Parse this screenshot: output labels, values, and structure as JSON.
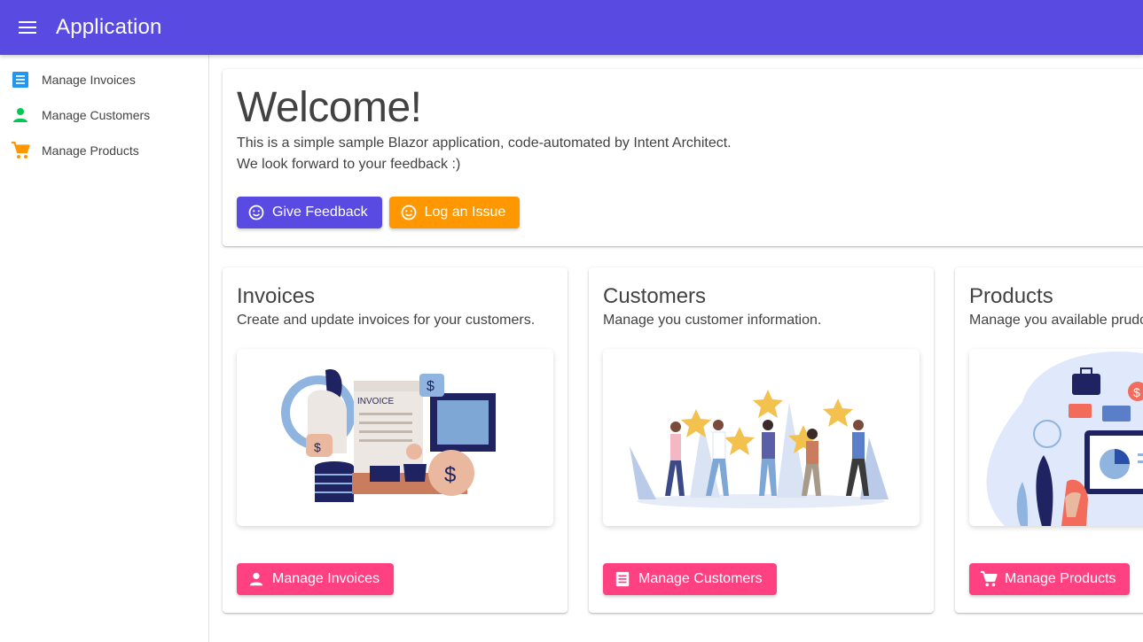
{
  "app": {
    "title": "Application",
    "brand_color": "#594ae2"
  },
  "nav": {
    "items": [
      {
        "label": "Manage Invoices",
        "icon": "receipt-icon",
        "color": "#2196f3"
      },
      {
        "label": "Manage Customers",
        "icon": "person-icon",
        "color": "#00c853"
      },
      {
        "label": "Manage Products",
        "icon": "cart-icon",
        "color": "#ff9800"
      }
    ]
  },
  "welcome": {
    "title": "Welcome!",
    "line1": "This is a simple sample Blazor application, code-automated by Intent Architect.",
    "line2": "We look forward to your feedback :)",
    "feedback_label": "Give Feedback",
    "issue_label": "Log an Issue"
  },
  "cards": [
    {
      "title": "Invoices",
      "description": "Create and update invoices for your customers.",
      "button_label": "Manage Invoices",
      "button_icon": "person-icon",
      "illustration_text": "INVOICE"
    },
    {
      "title": "Customers",
      "description": "Manage you customer information.",
      "button_label": "Manage Customers",
      "button_icon": "receipt-icon"
    },
    {
      "title": "Products",
      "description": "Manage you available prudcts.",
      "button_label": "Manage Products",
      "button_icon": "cart-icon"
    }
  ],
  "colors": {
    "primary": "#594ae2",
    "warning": "#ff9800",
    "secondary": "#ff4081"
  }
}
